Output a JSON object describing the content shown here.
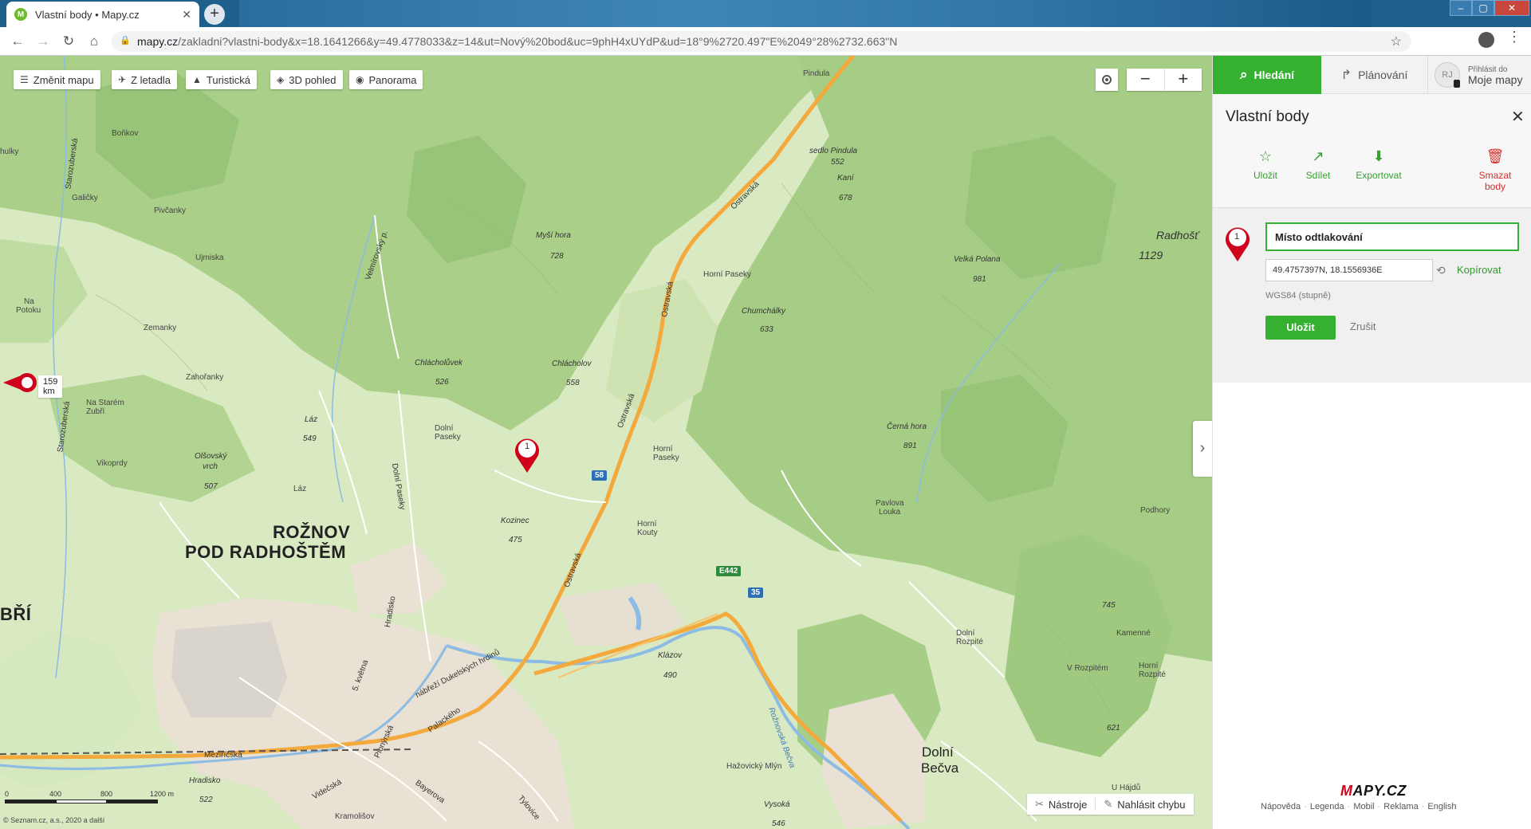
{
  "browser": {
    "tab_title": "Vlastní body • Mapy.cz",
    "url_host": "mapy.cz",
    "url_path": "/zakladni?vlastni-body&x=18.1641266&y=49.4778033&z=14&ut=Nový%20bod&uc=9phH4xUYdP&ud=18°9%2720.497\"E%2049°28%2732.663\"N"
  },
  "map_toolbar": {
    "change_map": "Změnit mapu",
    "aerial": "Z letadla",
    "tourist": "Turistická",
    "view_3d": "3D pohled",
    "panorama": "Panorama"
  },
  "map": {
    "distance_label": "159 km",
    "point_number": "1",
    "tools": "Nástroje",
    "report_error": "Nahlásit chybu",
    "scale_labels": [
      "0",
      "400",
      "800",
      "1200 m"
    ],
    "copyright": "© Seznam.cz, a.s., 2020 a další",
    "labels": {
      "big_town_1": "ROŽNOV",
      "big_town_2": "POD RADHOŠTĚM",
      "big_town_3": "BŘÍ",
      "dolni_becva_1": "Dolní",
      "dolni_becva_2": "Bečva",
      "radhost": "Radhošť",
      "radhost_ele": "1129",
      "pindula": "Pindula",
      "sedlo_pindula": "sedlo Pindula",
      "sedlo_ele": "552",
      "kani": "Kaní",
      "kani_ele": "678",
      "mysi_hora": "Myší hora",
      "mysi_ele": "728",
      "velka_polana": "Velká Polana",
      "velka_ele": "981",
      "chumchalky": "Chumchálky",
      "chum_ele": "633",
      "horni_paseky": "Horní Paseky",
      "chlacholuvek": "Chlácholůvek",
      "chlach_ele": "526",
      "chlacholov": "Chlácholov",
      "chlacholov_ele": "558",
      "cerna_hora": "Černá hora",
      "cerna_ele": "891",
      "laz": "Láz",
      "laz_ele": "549",
      "olsovsky": "Olšovský",
      "vrch": "vrch",
      "olsovsky_ele": "507",
      "dolni_paseky": "Dolní",
      "dolni_paseky2": "Paseky",
      "horni_paseky2a": "Horní",
      "horni_paseky2b": "Paseky",
      "kozinec": "Kozinec",
      "kozinec_ele": "475",
      "horni_kouty1": "Horní",
      "horni_kouty2": "Kouty",
      "pavlova1": "Pavlova",
      "pavlova2": "Louka",
      "podhory": "Podhory",
      "ele_745": "745",
      "kamenne": "Kamenné",
      "dolni_rozpite1": "Dolní",
      "dolni_rozpite2": "Rozpité",
      "v_rozpitem": "V Rozpitém",
      "horni_rozpite1": "Horní",
      "horni_rozpite2": "Rozpité",
      "ele_621": "621",
      "klazov": "Klázov",
      "klazov_ele": "490",
      "hazovicky": "Hažovický Mlýn",
      "u_hajdu": "U Hájdů",
      "vysoka": "Vysoká",
      "vysoka_ele": "546",
      "hradisko": "Hradisko",
      "hradisko_ele": "522",
      "kramolisov": "Kramolišov",
      "bonkov": "Boňkov",
      "galicky": "Galičky",
      "pivcanky": "Pivčanky",
      "ujmiska": "Ujmiska",
      "na_potoku1": "Na",
      "na_potoku2": "Potoku",
      "zemanky": "Zemanky",
      "zahorany": "Zahořanky",
      "na_starem1": "Na Starém",
      "na_starem2": "Zubří",
      "vikoprdy": "Vikoprdy",
      "laz2": "Láz",
      "hulky": "hulky",
      "ostravska1": "Ostravská",
      "ostravska2": "Ostravská",
      "ostravska3": "Ostravská",
      "ostravska4": "Ostravská",
      "velmirovsky": "Velmírovský p.",
      "starozuberska": "Starozuberská",
      "starozuberska2": "Starozuberská",
      "dolni_paseky_rd": "Dolní Paseky",
      "hradistko": "Hradisko",
      "kvetna": "5. května",
      "nabrezi": "nábřeží Dukelských hrdinů",
      "palackeho": "Palackého",
      "pionyrska": "Pionýrská",
      "bayerova": "Bayerova",
      "videcska": "Videčská",
      "tylovice": "Tylovice",
      "mezirecska": "Meziříčská",
      "roznovska": "Rožnovská Bečva"
    },
    "shields": {
      "r58": "58",
      "e442": "E442",
      "r35": "35"
    }
  },
  "panel": {
    "tab_search": "Hledání",
    "tab_plan": "Plánování",
    "login_small": "Přihlásit do",
    "login_big": "Moje mapy",
    "avatar": "RJ",
    "title": "Vlastní body",
    "actions": {
      "save": "Uložit",
      "share": "Sdílet",
      "export": "Exportovat",
      "delete_1": "Smazat",
      "delete_2": "body"
    },
    "point": {
      "number": "1",
      "name": "Místo odtlakování",
      "coords": "49.4757397N, 18.1556936E",
      "copy": "Kopírovat",
      "system": "WGS84 (stupně)",
      "save": "Uložit",
      "cancel": "Zrušit"
    },
    "logo_a": "M",
    "logo_b": "APY.CZ",
    "footer": [
      "Nápověda",
      "Legenda",
      "Mobil",
      "Reklama",
      "English"
    ]
  },
  "colors": {
    "accent_green": "#36b031",
    "marker_red": "#d0021b",
    "forest": "#a8cf8a",
    "meadow": "#e3edcf",
    "road_orange": "#f3a83b"
  }
}
